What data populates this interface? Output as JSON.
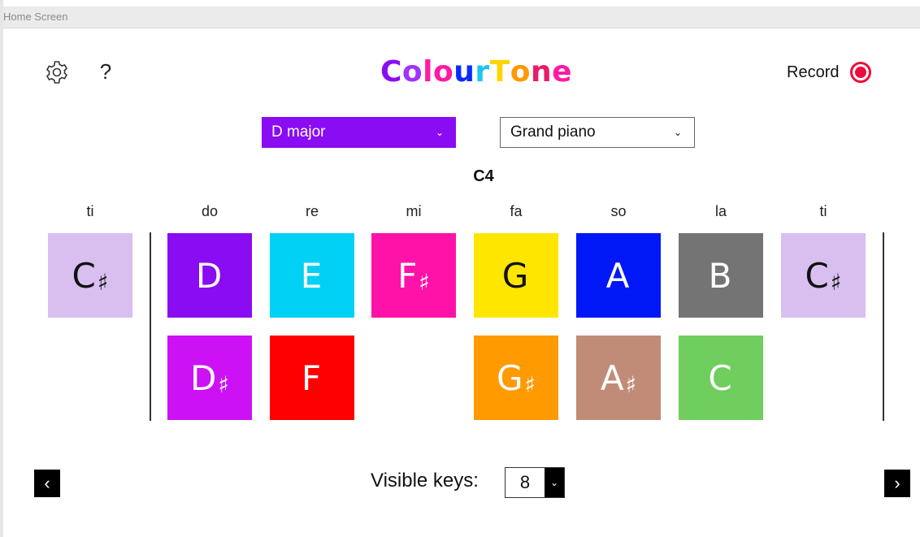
{
  "window": {
    "title": "Home Screen"
  },
  "header": {
    "logo_letters": [
      {
        "char": "C",
        "color": "#8a0cf2"
      },
      {
        "char": "o",
        "color": "#a033ff"
      },
      {
        "char": "l",
        "color": "#ff1aa3"
      },
      {
        "char": "o",
        "color": "#ff1aa3"
      },
      {
        "char": "u",
        "color": "#0a2bff"
      },
      {
        "char": "r",
        "color": "#1fc4f2"
      },
      {
        "char": "T",
        "color": "#ffd400"
      },
      {
        "char": "o",
        "color": "#ff9900"
      },
      {
        "char": "n",
        "color": "#e81c6a"
      },
      {
        "char": "e",
        "color": "#ff1aa3"
      }
    ],
    "help_label": "?",
    "record_label": "Record"
  },
  "controls": {
    "key_select": {
      "value": "D major",
      "bg": "#8a0cf2"
    },
    "instrument_select": {
      "value": "Grand piano"
    }
  },
  "octave_label": "C4",
  "solfege": [
    "ti",
    "do",
    "re",
    "mi",
    "fa",
    "so",
    "la",
    "ti"
  ],
  "tiles_top": [
    {
      "note": "C",
      "sharp": "♯",
      "color": "#d8bff0",
      "text": "#111"
    },
    {
      "note": "D",
      "sharp": "",
      "color": "#8a0cf2",
      "text": "#fff"
    },
    {
      "note": "E",
      "sharp": "",
      "color": "#00d1f5",
      "text": "#fff"
    },
    {
      "note": "F",
      "sharp": "♯",
      "color": "#ff12a8",
      "text": "#fff"
    },
    {
      "note": "G",
      "sharp": "",
      "color": "#ffe600",
      "text": "#111"
    },
    {
      "note": "A",
      "sharp": "",
      "color": "#0018f5",
      "text": "#fff"
    },
    {
      "note": "B",
      "sharp": "",
      "color": "#747474",
      "text": "#fff"
    },
    {
      "note": "C",
      "sharp": "♯",
      "color": "#d8bff0",
      "text": "#111"
    }
  ],
  "tiles_bottom": [
    {
      "note": "D",
      "sharp": "♯",
      "color": "#cc12f5",
      "text": "#fff"
    },
    {
      "note": "F",
      "sharp": "",
      "color": "#fe0000",
      "text": "#fff"
    },
    {
      "note": "G",
      "sharp": "♯",
      "color": "#ff9a00",
      "text": "#fff"
    },
    {
      "note": "A",
      "sharp": "♯",
      "color": "#c08c78",
      "text": "#fff"
    },
    {
      "note": "C",
      "sharp": "",
      "color": "#6fce5e",
      "text": "#fff"
    }
  ],
  "footer": {
    "visible_keys_label": "Visible keys:",
    "visible_keys_value": "8",
    "prev_label": "‹",
    "next_label": "›"
  }
}
